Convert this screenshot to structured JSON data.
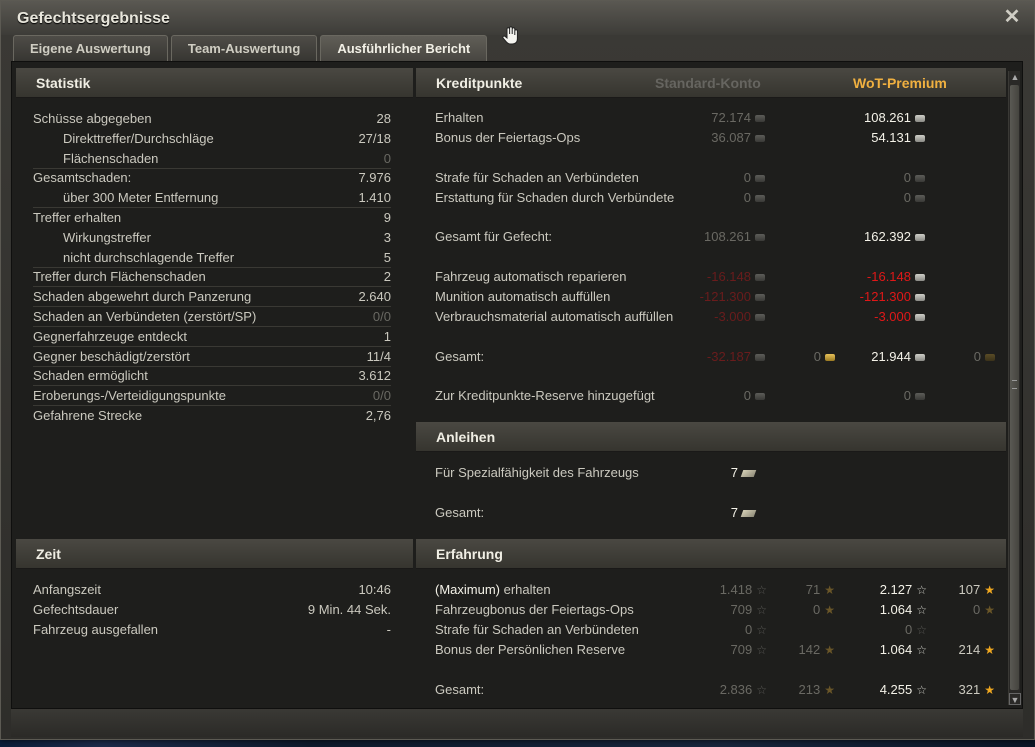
{
  "window": {
    "title": "Gefechtsergebnisse"
  },
  "tabs": [
    {
      "label": "Eigene Auswertung"
    },
    {
      "label": "Team-Auswertung"
    },
    {
      "label": "Ausführlicher Bericht"
    }
  ],
  "statistik": {
    "title": "Statistik",
    "rows": [
      {
        "label": "Schüsse abgegeben",
        "value": "28"
      },
      {
        "label": "Direkttreffer/Durchschläge",
        "value": "27/18"
      },
      {
        "label": "Flächenschaden",
        "value": "0"
      },
      {
        "label": "Gesamtschaden:",
        "value": "7.976"
      },
      {
        "label": "über 300 Meter Entfernung",
        "value": "1.410"
      },
      {
        "label": "Treffer erhalten",
        "value": "9"
      },
      {
        "label": "Wirkungstreffer",
        "value": "3"
      },
      {
        "label": "nicht durchschlagende Treffer",
        "value": "5"
      },
      {
        "label": "Treffer durch Flächenschaden",
        "value": "2"
      },
      {
        "label": "Schaden abgewehrt durch Panzerung",
        "value": "2.640"
      },
      {
        "label": "Schaden an Verbündeten (zerstört/SP)",
        "value": "0/0"
      },
      {
        "label": "Gegnerfahrzeuge entdeckt",
        "value": "1"
      },
      {
        "label": "Gegner beschädigt/zerstört",
        "value": "11/4"
      },
      {
        "label": "Schaden ermöglicht",
        "value": "3.612"
      },
      {
        "label": "Eroberungs-/Verteidigungspunkte",
        "value": "0/0"
      },
      {
        "label": "Gefahrene Strecke",
        "value": "2,76"
      }
    ]
  },
  "zeit": {
    "title": "Zeit",
    "rows": [
      {
        "label": "Anfangszeit",
        "value": "10:46"
      },
      {
        "label": "Gefechtsdauer",
        "value": "9 Min. 44 Sek."
      },
      {
        "label": "Fahrzeug ausgefallen",
        "value": "-"
      }
    ]
  },
  "kredit": {
    "title": "Kreditpunkte",
    "col_standard": "Standard-Konto",
    "col_premium": "WoT-Premium",
    "rows": {
      "erhalten": {
        "label": "Erhalten",
        "std": "72.174",
        "prem": "108.261"
      },
      "bonus": {
        "label": "Bonus der Feiertags-Ops",
        "std": "36.087",
        "prem": "54.131"
      },
      "strafe": {
        "label": "Strafe für Schaden an Verbündeten",
        "std": "0",
        "prem": "0"
      },
      "erstattung": {
        "label": "Erstattung für Schaden durch Verbündete",
        "std": "0",
        "prem": "0"
      },
      "gesamt_gefecht": {
        "label": "Gesamt für Gefecht:",
        "std": "108.261",
        "prem": "162.392"
      },
      "reparieren": {
        "label": "Fahrzeug automatisch reparieren",
        "std": "-16.148",
        "prem": "-16.148"
      },
      "munition": {
        "label": "Munition automatisch auffüllen",
        "std": "-121.300",
        "prem": "-121.300"
      },
      "verbrauch": {
        "label": "Verbrauchsmaterial automatisch auffüllen",
        "std": "-3.000",
        "prem": "-3.000"
      },
      "gesamt": {
        "label": "Gesamt:",
        "std": "-32.187",
        "std_gold": "0",
        "prem": "21.944",
        "prem_gold": "0"
      },
      "reserve": {
        "label": "Zur Kreditpunkte-Reserve hinzugefügt",
        "std": "0",
        "prem": "0"
      }
    }
  },
  "anleihen": {
    "title": "Anleihen",
    "rows": [
      {
        "label": "Für Spezialfähigkeit des Fahrzeugs",
        "value": "7"
      },
      {
        "label": "Gesamt:",
        "value": "7"
      }
    ]
  },
  "erfahrung": {
    "title": "Erfahrung",
    "rows": {
      "maximum": {
        "label_paren": "(Maximum)",
        "label_rest": " erhalten",
        "std": "1.418",
        "std_free": "71",
        "prem": "2.127",
        "prem_free": "107"
      },
      "bonus": {
        "label": "Fahrzeugbonus der Feiertags-Ops",
        "std": "709",
        "std_free": "0",
        "prem": "1.064",
        "prem_free": "0"
      },
      "strafe": {
        "label": "Strafe für Schaden an Verbündeten",
        "std": "0",
        "prem": "0"
      },
      "reserve": {
        "label": "Bonus der Persönlichen Reserve",
        "std": "709",
        "std_free": "142",
        "prem": "1.064",
        "prem_free": "214"
      },
      "gesamt": {
        "label": "Gesamt:",
        "std": "2.836",
        "std_free": "213",
        "prem": "4.255",
        "prem_free": "321"
      }
    }
  },
  "icons": {
    "close": "close-icon",
    "cursor": "hand-cursor-icon",
    "credit": "credit-coin-icon",
    "gold": "gold-coin-icon",
    "xp": "xp-star-icon",
    "free_xp": "free-xp-star-icon",
    "bond": "bond-icon"
  },
  "colors": {
    "premium_header": "#f0b040",
    "negative": "#e01818",
    "muted": "#6a6963"
  }
}
